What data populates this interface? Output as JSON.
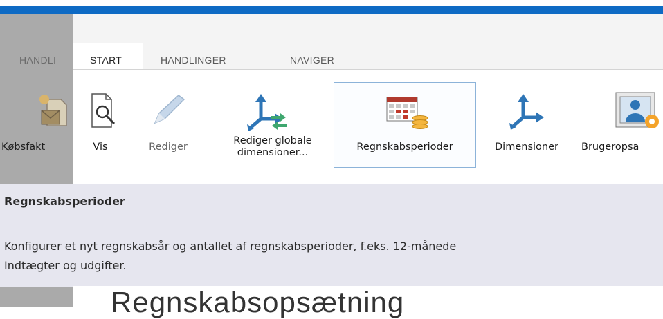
{
  "tabs": {
    "left_cut": "HANDLI",
    "start": "START",
    "handlinger": "HANDLINGER",
    "naviger": "NAVIGER"
  },
  "ribbon": {
    "kobsfakt": "Købsfakt",
    "vis": "Vis",
    "rediger": "Rediger",
    "rediger_globale_line1": "Rediger globale",
    "rediger_globale_line2": "dimensioner...",
    "regnskabsperioder": "Regnskabsperioder",
    "dimensioner": "Dimensioner",
    "brugeropsa": "Brugeropsa"
  },
  "tooltip": {
    "title": "Regnskabsperioder",
    "description_line1": "Konfigurer et nyt regnskabsår og antallet af regnskabsperioder, f.eks. 12-månede",
    "description_line2": "Indtægter og udgifter."
  },
  "page": {
    "heading": "Regnskabsopsætning"
  },
  "colors": {
    "accent": "#0e6ac4",
    "tooltip_bg": "#e6e6ef",
    "icon_blue": "#2e75b6",
    "icon_green": "#3fa76f",
    "icon_orange": "#f4a32a"
  }
}
